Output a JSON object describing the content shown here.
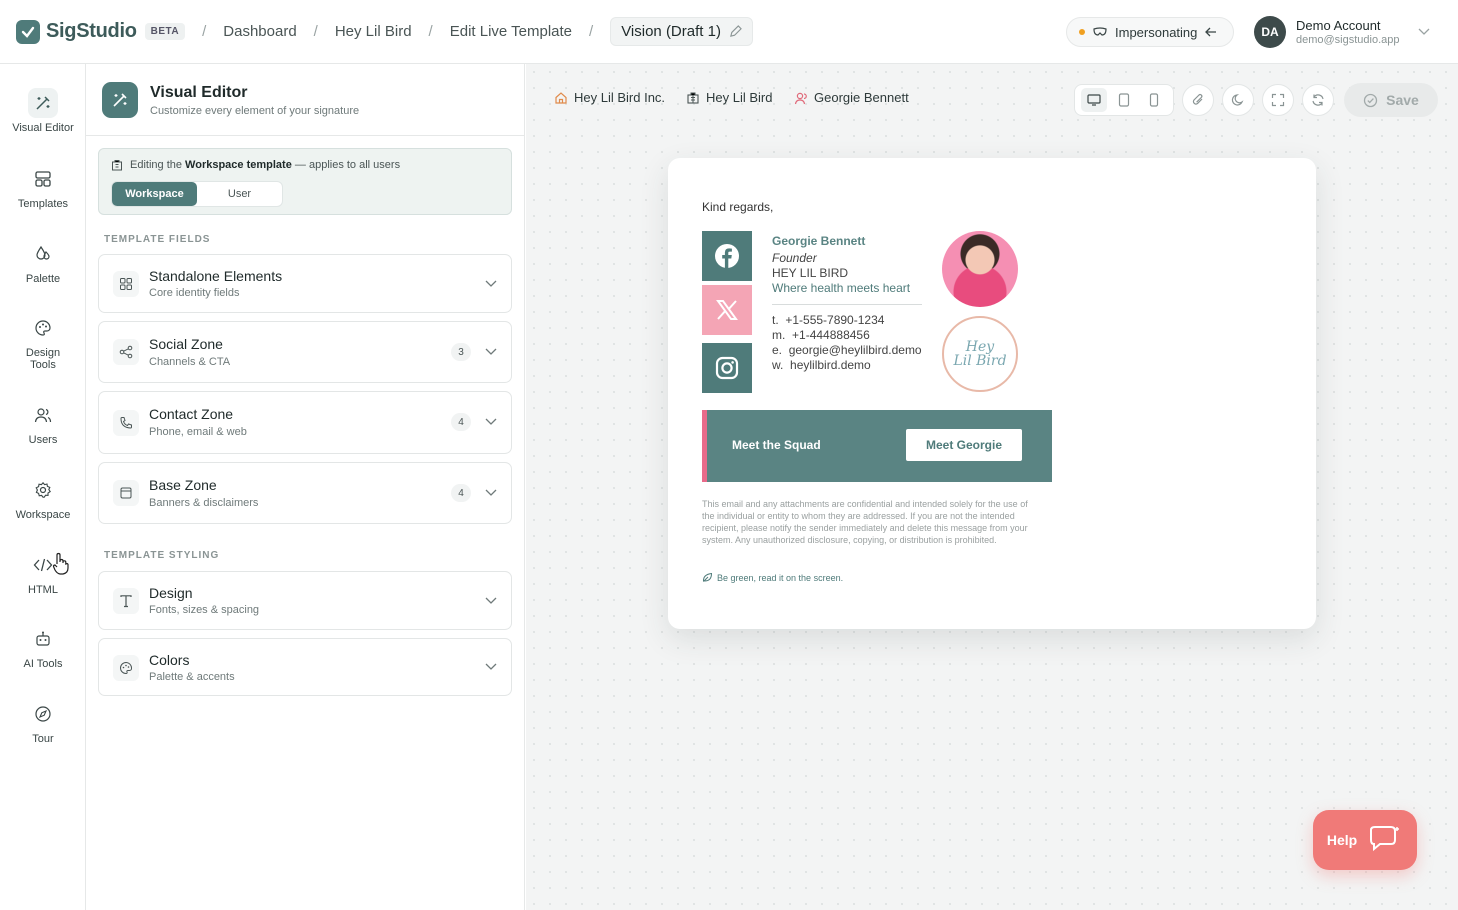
{
  "header": {
    "brand": "SigStudio",
    "beta": "BETA",
    "breadcrumbs": [
      "Dashboard",
      "Hey Lil Bird",
      "Edit Live Template",
      "Vision (Draft 1)"
    ],
    "impersonating": "Impersonating",
    "account": {
      "initials": "DA",
      "name": "Demo Account",
      "email": "demo@sigstudio.app"
    }
  },
  "rail": [
    {
      "label": "Visual Editor",
      "icon": "wand-icon",
      "active": true
    },
    {
      "label": "Templates",
      "icon": "layout-icon"
    },
    {
      "label": "Palette",
      "icon": "droplet-icon"
    },
    {
      "label": "Design Tools",
      "icon": "palette-icon"
    },
    {
      "label": "Users",
      "icon": "users-icon"
    },
    {
      "label": "Workspace",
      "icon": "gear-icon"
    },
    {
      "label": "HTML",
      "icon": "code-icon"
    },
    {
      "label": "AI Tools",
      "icon": "bot-icon"
    },
    {
      "label": "Tour",
      "icon": "compass-icon"
    }
  ],
  "panel": {
    "title": "Visual Editor",
    "subtitle": "Customize every element of your signature",
    "editing_prefix": "Editing the",
    "editing_bold": "Workspace template",
    "editing_suffix": "— applies to all users",
    "segments": [
      "Workspace",
      "User"
    ],
    "fields_heading": "TEMPLATE FIELDS",
    "styling_heading": "TEMPLATE STYLING",
    "fields": [
      {
        "title": "Standalone Elements",
        "sub": "Core identity fields",
        "count": "",
        "icon": "grid-icon"
      },
      {
        "title": "Social Zone",
        "sub": "Channels & CTA",
        "count": "3",
        "icon": "share-icon"
      },
      {
        "title": "Contact Zone",
        "sub": "Phone, email & web",
        "count": "4",
        "icon": "phone-icon"
      },
      {
        "title": "Base Zone",
        "sub": "Banners & disclaimers",
        "count": "4",
        "icon": "panel-icon"
      }
    ],
    "styling": [
      {
        "title": "Design",
        "sub": "Fonts, sizes & spacing",
        "icon": "type-icon"
      },
      {
        "title": "Colors",
        "sub": "Palette & accents",
        "icon": "palette-icon"
      }
    ]
  },
  "canvas": {
    "context": [
      "Hey Lil Bird Inc.",
      "Hey Lil Bird",
      "Georgie Bennett"
    ],
    "save": "Save"
  },
  "signature": {
    "greeting": "Kind regards,",
    "name": "Georgie Bennett",
    "role": "Founder",
    "company": "HEY LIL BIRD",
    "tagline": "Where health meets heart",
    "contacts": [
      {
        "k": "t.",
        "v": "+1-555-7890-1234"
      },
      {
        "k": "m.",
        "v": "+1-444888456"
      },
      {
        "k": "e.",
        "v": "georgie@heylilbird.demo"
      },
      {
        "k": "w.",
        "v": "heylilbird.demo"
      }
    ],
    "logo_line1": "Hey",
    "logo_line2": "Lil Bird",
    "banner_text": "Meet the Squad",
    "banner_button": "Meet Georgie",
    "disclaimer": "This email and any attachments are confidential and intended solely for the use of the individual or entity to whom they are addressed. If you are not the intended recipient, please notify the sender immediately and delete this message from your system. Any unauthorized disclosure, copying, or distribution is prohibited.",
    "green_note": "Be green, read it on the screen.",
    "colors": {
      "primary": "#5a8483",
      "accent": "#e86a8a",
      "social_bg": "#4f7b7a",
      "social_alt": "#f4a5b5"
    }
  },
  "help": "Help"
}
